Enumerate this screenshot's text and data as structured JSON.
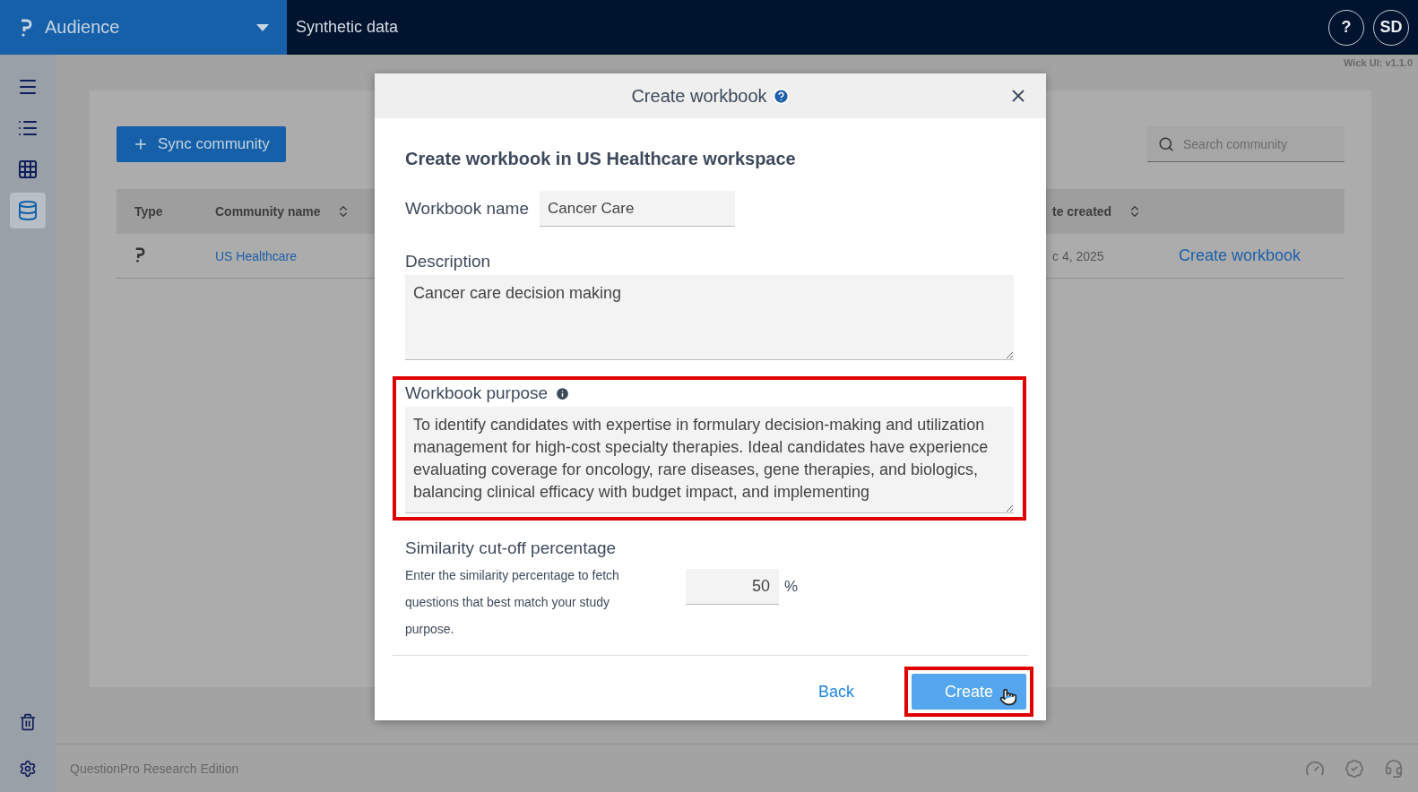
{
  "header": {
    "app_name": "Audience",
    "page_title": "Synthetic data",
    "help_label": "?",
    "avatar": "SD"
  },
  "version": "Wick UI: v1.1.0",
  "sidebar": {
    "items": [
      {
        "kind": "menu",
        "selected": false
      },
      {
        "kind": "list",
        "selected": false
      },
      {
        "kind": "grid",
        "selected": false
      },
      {
        "kind": "database",
        "selected": true
      }
    ],
    "bottom_items": [
      {
        "kind": "trash"
      },
      {
        "kind": "settings"
      }
    ]
  },
  "toolbar": {
    "sync_button": "Sync community",
    "search_placeholder": "Search community"
  },
  "table": {
    "columns": [
      {
        "label": "Type",
        "sortable": false
      },
      {
        "label": "Community name",
        "sortable": true
      },
      {
        "label": "te created",
        "sortable": true
      }
    ],
    "rows": [
      {
        "community_name": "US Healthcare",
        "date": "c 4, 2025",
        "action": "Create workbook"
      }
    ]
  },
  "modal": {
    "title": "Create workbook",
    "heading": "Create workbook in US Healthcare workspace",
    "workbook_name": {
      "label": "Workbook name",
      "value": "Cancer Care"
    },
    "description": {
      "label": "Description",
      "value": "Cancer care decision making"
    },
    "purpose": {
      "label": "Workbook purpose",
      "value": "To identify candidates with expertise in formulary decision-making and utilization management for high-cost specialty therapies. Ideal candidates have experience evaluating coverage for oncology, rare diseases, gene therapies, and biologics, balancing clinical efficacy with budget impact, and implementing"
    },
    "similarity": {
      "label": "Similarity cut-off percentage",
      "help": "Enter the similarity percentage to fetch questions that best match your study purpose.",
      "value": "50",
      "unit": "%"
    },
    "back_button": "Back",
    "create_button": "Create"
  },
  "footer": {
    "text": "QuestionPro Research Edition"
  }
}
